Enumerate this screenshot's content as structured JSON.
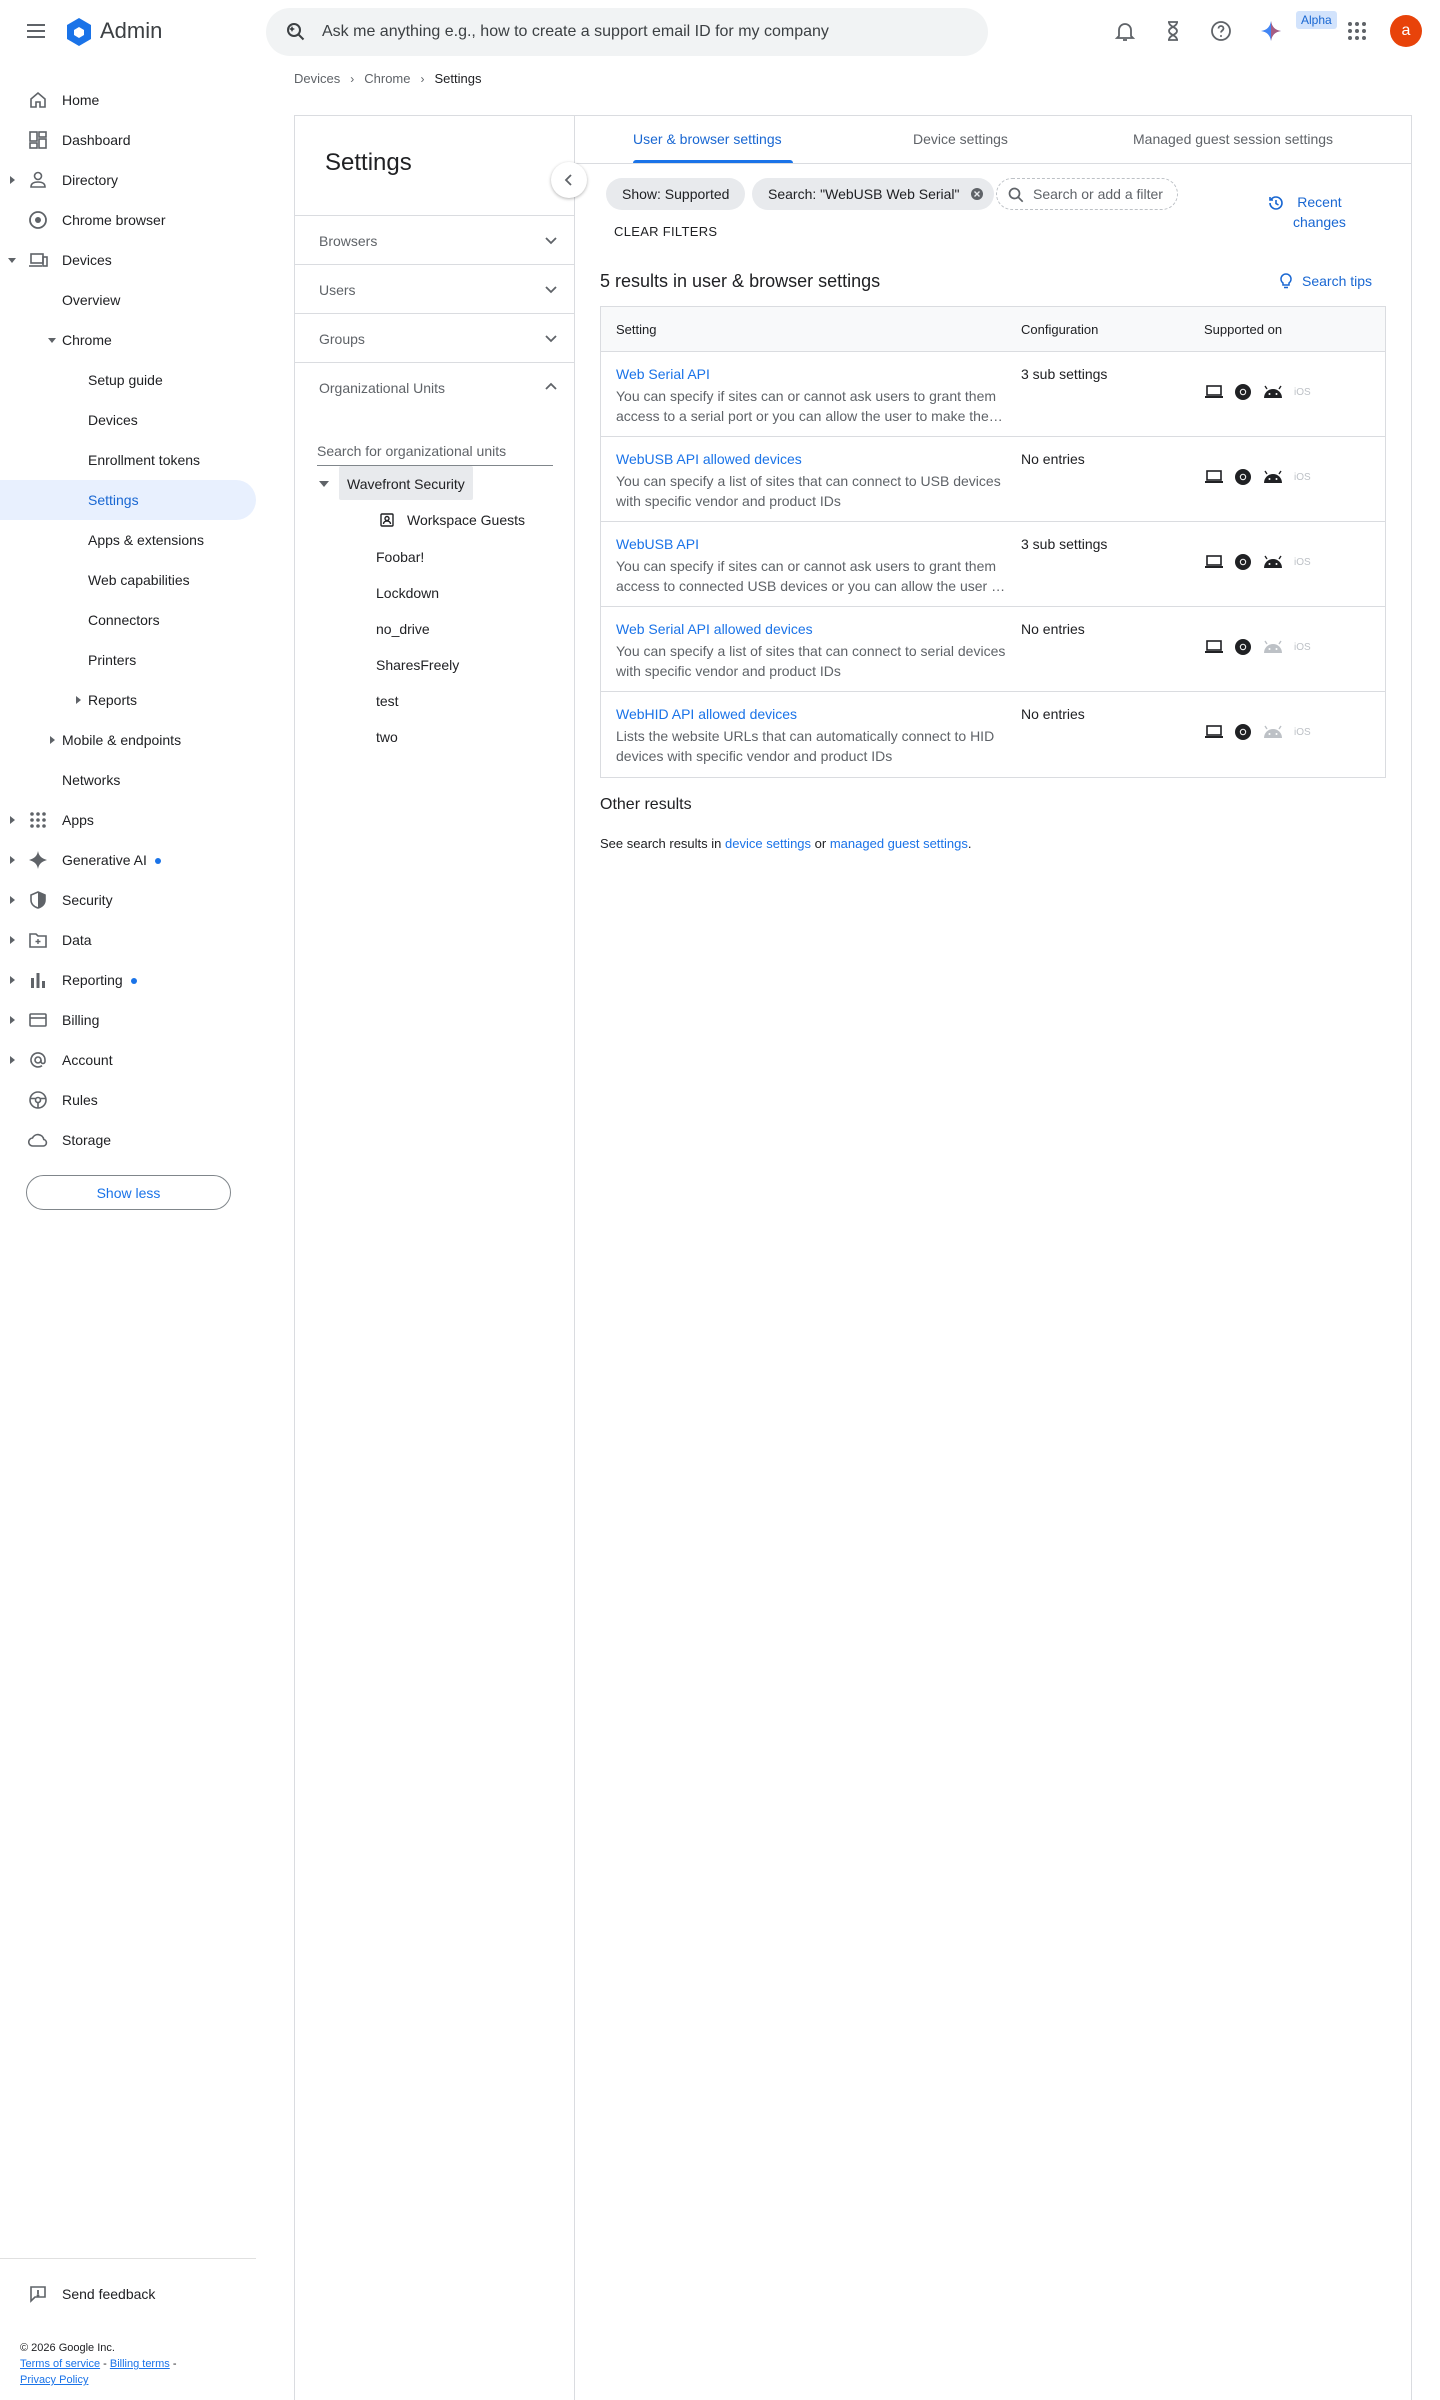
{
  "topbar": {
    "app_name": "Admin",
    "search_placeholder": "Ask me anything e.g., how to create a support email ID for my company",
    "alpha_badge": "Alpha",
    "avatar_letter": "a"
  },
  "breadcrumb": [
    "Devices",
    "Chrome",
    "Settings"
  ],
  "sidebar": {
    "items": [
      {
        "label": "Home",
        "icon": "home-icon"
      },
      {
        "label": "Dashboard",
        "icon": "dashboard-icon"
      },
      {
        "label": "Directory",
        "icon": "person-icon"
      },
      {
        "label": "Chrome browser",
        "icon": "chrome-icon"
      },
      {
        "label": "Devices",
        "icon": "devices-icon"
      },
      {
        "label": "Overview"
      },
      {
        "label": "Chrome"
      },
      {
        "label": "Setup guide"
      },
      {
        "label": "Devices"
      },
      {
        "label": "Enrollment tokens"
      },
      {
        "label": "Settings"
      },
      {
        "label": "Apps & extensions"
      },
      {
        "label": "Web capabilities"
      },
      {
        "label": "Connectors"
      },
      {
        "label": "Printers"
      },
      {
        "label": "Reports"
      },
      {
        "label": "Mobile & endpoints"
      },
      {
        "label": "Networks"
      },
      {
        "label": "Apps",
        "icon": "apps-grid-icon"
      },
      {
        "label": "Generative AI",
        "icon": "sparkle-icon"
      },
      {
        "label": "Security",
        "icon": "shield-icon"
      },
      {
        "label": "Data",
        "icon": "folder-icon"
      },
      {
        "label": "Reporting",
        "icon": "bar-chart-icon"
      },
      {
        "label": "Billing",
        "icon": "credit-card-icon"
      },
      {
        "label": "Account",
        "icon": "at-sign-icon"
      },
      {
        "label": "Rules",
        "icon": "steering-icon"
      },
      {
        "label": "Storage",
        "icon": "cloud-icon"
      }
    ],
    "show_less": "Show less",
    "send_feedback": "Send feedback",
    "footer": {
      "copyright": "© 2026 Google Inc.",
      "terms": "Terms of service",
      "billing_terms": "Billing terms",
      "privacy": "Privacy Policy"
    }
  },
  "ou_panel": {
    "title": "Settings",
    "accordions": [
      "Browsers",
      "Users",
      "Groups",
      "Organizational Units"
    ],
    "search_placeholder": "Search for organizational units",
    "root": "Wavefront Security",
    "children": [
      "Workspace Guests",
      "Foobar!",
      "Lockdown",
      "no_drive",
      "SharesFreely",
      "test",
      "two"
    ]
  },
  "main": {
    "tabs": [
      "User & browser settings",
      "Device settings",
      "Managed guest session settings"
    ],
    "chips": [
      "Show: Supported",
      "Search: \"WebUSB Web Serial\""
    ],
    "filter_placeholder": "Search or add a filter",
    "clear_filters": "CLEAR FILTERS",
    "recent_changes_line1": "Recent",
    "recent_changes_line2": "changes",
    "results_title": "5 results in user & browser settings",
    "search_tips": "Search tips",
    "table_headers": [
      "Setting",
      "Configuration",
      "Supported on"
    ],
    "rows": [
      {
        "name": "Web Serial API",
        "desc": "You can specify if sites can or cannot ask users to grant them access to a serial port or you can allow the user to make the choice",
        "config": "3 sub settings",
        "android_enabled": true
      },
      {
        "name": "WebUSB API allowed devices",
        "desc": "You can specify a list of sites that can connect to USB devices with specific vendor and product IDs",
        "config": "No entries",
        "android_enabled": true
      },
      {
        "name": "WebUSB API",
        "desc": "You can specify if sites can or cannot ask users to grant them access to connected USB devices or you can allow the user to choose",
        "config": "3 sub settings",
        "android_enabled": true
      },
      {
        "name": "Web Serial API allowed devices",
        "desc": "You can specify a list of sites that can connect to serial devices with specific vendor and product IDs",
        "config": "No entries",
        "android_enabled": false
      },
      {
        "name": "WebHID API allowed devices",
        "desc": "Lists the website URLs that can automatically connect to HID devices with specific vendor and product IDs",
        "config": "No entries",
        "android_enabled": false
      }
    ],
    "platform_ios": "iOS",
    "other_title": "Other results",
    "other_prefix": "See search results in",
    "other_link1": "device settings",
    "other_mid": "or",
    "other_link2": "managed guest settings",
    "other_suffix": "."
  }
}
